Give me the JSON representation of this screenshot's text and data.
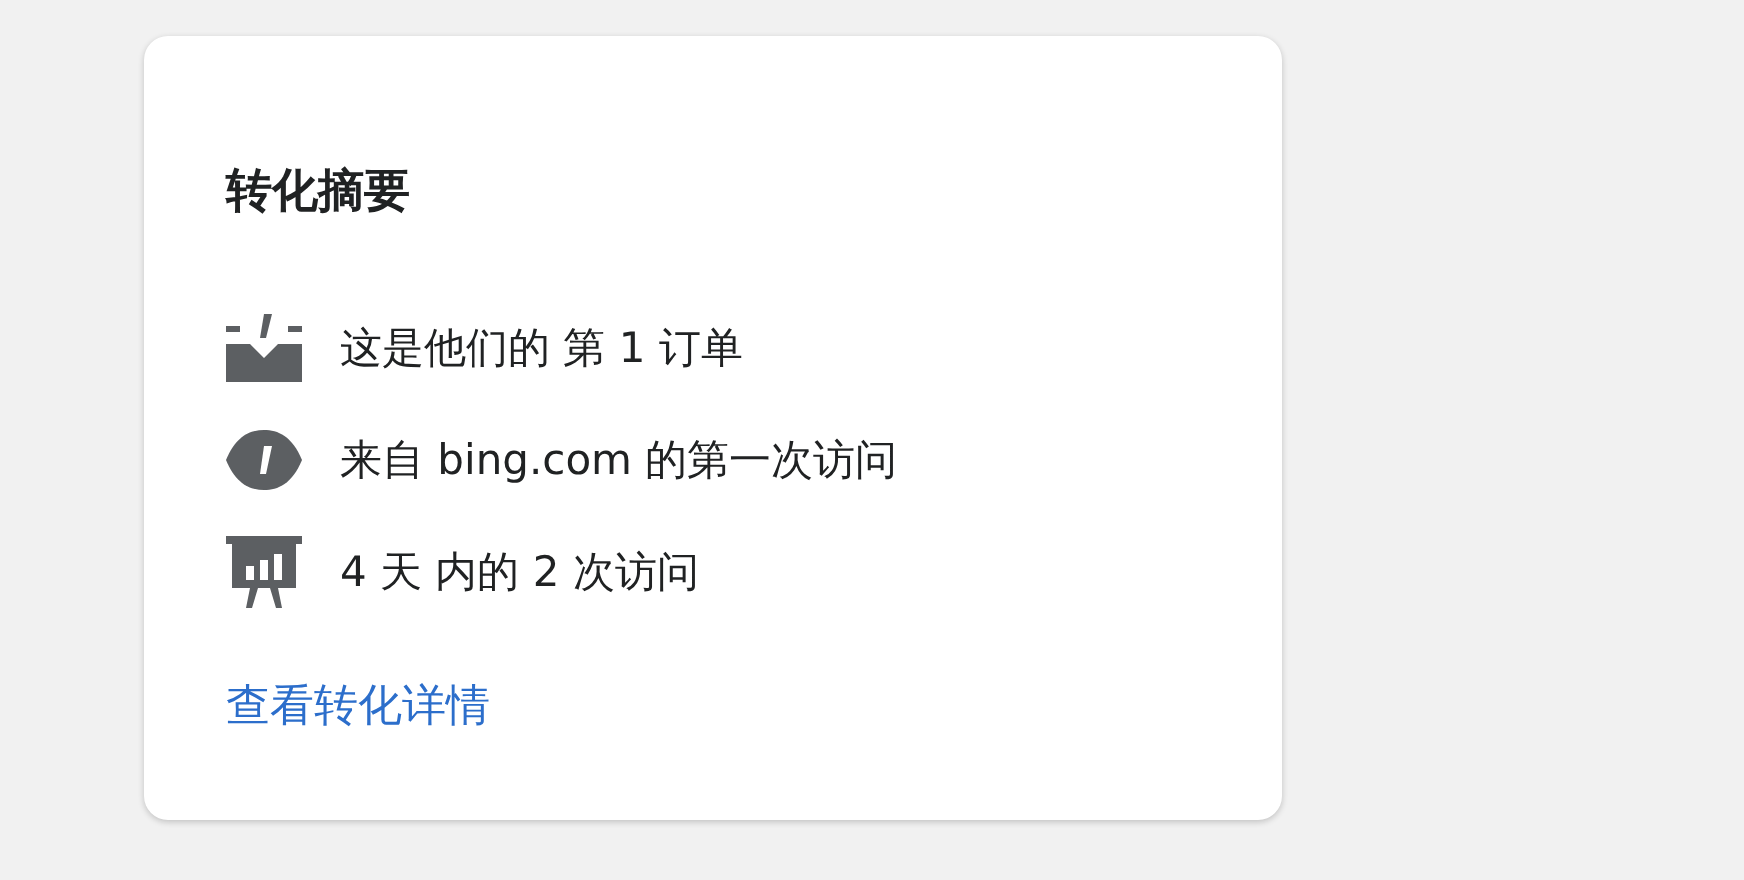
{
  "card": {
    "title": "转化摘要",
    "items": [
      {
        "kind": "order",
        "text": "这是他们的 第 1 订单"
      },
      {
        "kind": "visit",
        "text": "来自 bing.com 的第一次访问"
      },
      {
        "kind": "sessions",
        "text": "4 天 内的 2 次访问"
      }
    ],
    "link": "查看转化详情"
  }
}
